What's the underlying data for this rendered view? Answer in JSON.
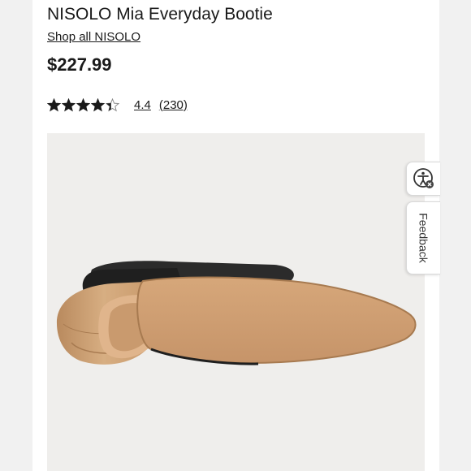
{
  "product": {
    "title": "NISOLO Mia Everyday Bootie",
    "shop_link": "Shop all NISOLO",
    "price": "$227.99",
    "rating": {
      "value": "4.4",
      "count": "(230)",
      "stars_filled": 4.4,
      "stars_max": 5
    }
  },
  "image": {
    "alt_icon": "boot-sole-image"
  },
  "widgets": {
    "accessibility_icon": "accessibility-icon",
    "feedback_label": "Feedback"
  },
  "colors": {
    "text": "#1a1a1a",
    "star": "#1a1a1a",
    "image_bg": "#efeeec"
  }
}
